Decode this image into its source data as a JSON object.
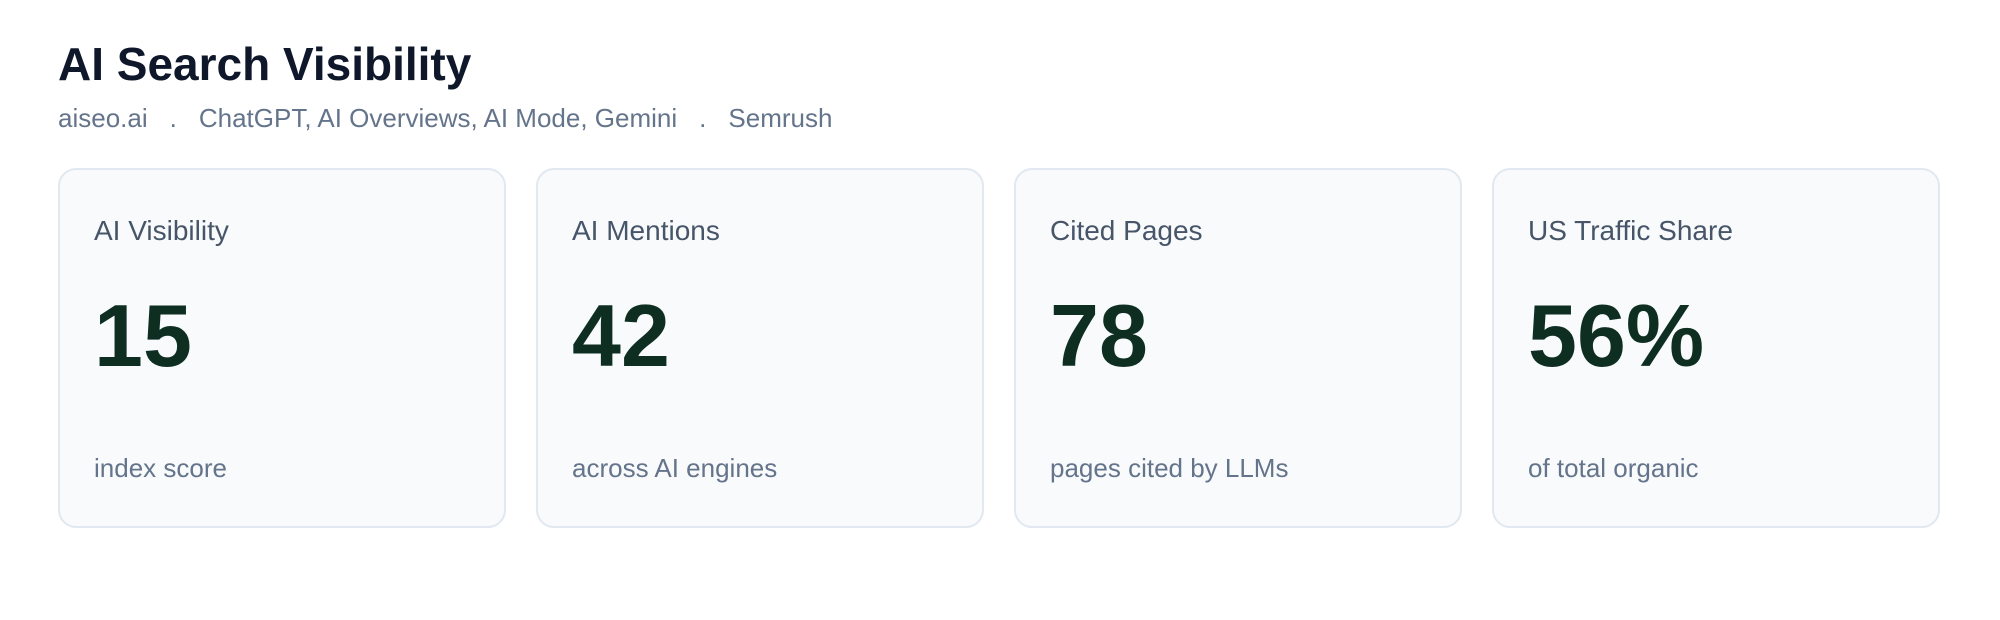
{
  "header": {
    "title": "AI Search Visibility",
    "domain": "aiseo.ai",
    "separator": ".",
    "engines": "ChatGPT, AI Overviews, AI Mode, Gemini",
    "source": "Semrush"
  },
  "cards": [
    {
      "label": "AI Visibility",
      "value": "15",
      "caption": "index score"
    },
    {
      "label": "AI Mentions",
      "value": "42",
      "caption": "across AI engines"
    },
    {
      "label": "Cited Pages",
      "value": "78",
      "caption": "pages cited by LLMs"
    },
    {
      "label": "US Traffic Share",
      "value": "56%",
      "caption": "of total organic"
    }
  ],
  "colors": {
    "title": "#0f172a",
    "muted": "#64748b",
    "value": "#0f2e22",
    "card_bg": "#f8fafc",
    "card_border": "#e2e8f0"
  }
}
